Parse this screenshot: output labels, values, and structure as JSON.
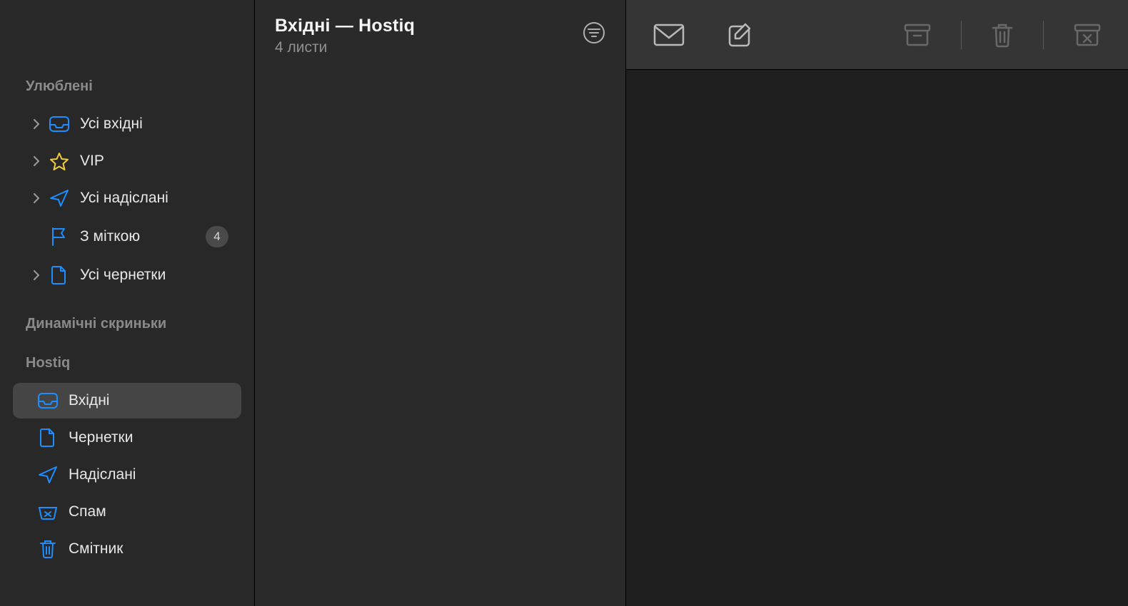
{
  "sidebar": {
    "favorites_header": "Улюблені",
    "dynamic_header": "Динамічні скриньки",
    "account_header": "Hostiq",
    "favorites": [
      {
        "label": "Усі вхідні",
        "icon": "inbox",
        "has_chevron": true
      },
      {
        "label": "VIP",
        "icon": "star",
        "has_chevron": true
      },
      {
        "label": "Усі надіслані",
        "icon": "sent",
        "has_chevron": true
      },
      {
        "label": "З міткою",
        "icon": "flag",
        "has_chevron": false,
        "badge": "4"
      },
      {
        "label": "Усі чернетки",
        "icon": "draft",
        "has_chevron": true
      }
    ],
    "account_items": [
      {
        "label": "Вхідні",
        "icon": "inbox",
        "selected": true
      },
      {
        "label": "Чернетки",
        "icon": "draft"
      },
      {
        "label": "Надіслані",
        "icon": "sent"
      },
      {
        "label": "Спам",
        "icon": "spam"
      },
      {
        "label": "Смітник",
        "icon": "trash"
      }
    ]
  },
  "message_list": {
    "title": "Вхідні — Hostiq",
    "subtitle": "4 листи"
  }
}
